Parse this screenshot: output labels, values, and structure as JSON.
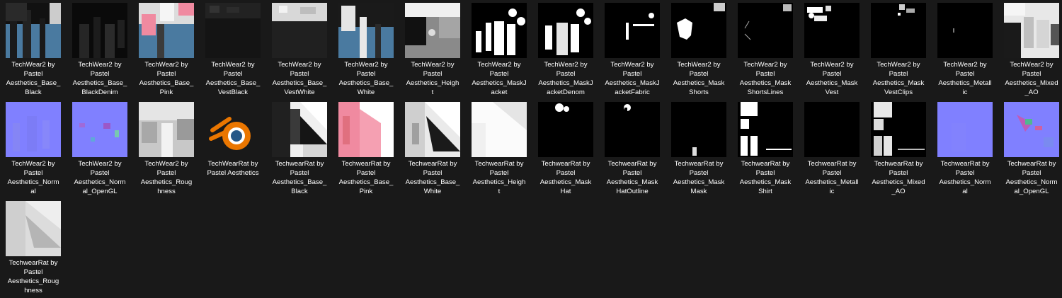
{
  "files": [
    {
      "label": "TechWear2 by\nPastel\nAesthetics_Base_\nBlack",
      "icon": "texture-thumbnail-base-black"
    },
    {
      "label": "TechWear2 by\nPastel\nAesthetics_Base_\nBlackDenim",
      "icon": "texture-thumbnail-base-blackdenim"
    },
    {
      "label": "TechWear2 by\nPastel\nAesthetics_Base_\nPink",
      "icon": "texture-thumbnail-base-pink"
    },
    {
      "label": "TechWear2 by\nPastel\nAesthetics_Base_\nVestBlack",
      "icon": "texture-thumbnail-base-vestblack"
    },
    {
      "label": "TechWear2 by\nPastel\nAesthetics_Base_\nVestWhite",
      "icon": "texture-thumbnail-base-vestwhite"
    },
    {
      "label": "TechWear2 by\nPastel\nAesthetics_Base_\nWhite",
      "icon": "texture-thumbnail-base-white"
    },
    {
      "label": "TechWear2 by\nPastel\nAesthetics_Heigh\nt",
      "icon": "texture-thumbnail-height"
    },
    {
      "label": "TechWear2 by\nPastel\nAesthetics_MaskJ\nacket",
      "icon": "texture-thumbnail-maskjacket"
    },
    {
      "label": "TechWear2 by\nPastel\nAesthetics_MaskJ\nacketDenom",
      "icon": "texture-thumbnail-maskjacketdenom"
    },
    {
      "label": "TechWear2 by\nPastel\nAesthetics_MaskJ\nacketFabric",
      "icon": "texture-thumbnail-maskjacketfabric"
    },
    {
      "label": "TechWear2 by\nPastel\nAesthetics_Mask\nShorts",
      "icon": "texture-thumbnail-maskshorts"
    },
    {
      "label": "TechWear2 by\nPastel\nAesthetics_Mask\nShortsLines",
      "icon": "texture-thumbnail-maskshortslines"
    },
    {
      "label": "TechWear2 by\nPastel\nAesthetics_Mask\nVest",
      "icon": "texture-thumbnail-maskvest"
    },
    {
      "label": "TechWear2 by\nPastel\nAesthetics_Mask\nVestClips",
      "icon": "texture-thumbnail-maskvestclips"
    },
    {
      "label": "TechWear2 by\nPastel\nAesthetics_Metall\nic",
      "icon": "texture-thumbnail-metallic"
    },
    {
      "label": "TechWear2 by\nPastel\nAesthetics_Mixed\n_AO",
      "icon": "texture-thumbnail-mixed-ao"
    },
    {
      "label": "TechWear2 by\nPastel\nAesthetics_Norm\nal",
      "icon": "texture-thumbnail-normal"
    },
    {
      "label": "TechWear2 by\nPastel\nAesthetics_Norm\nal_OpenGL",
      "icon": "texture-thumbnail-normal-opengl"
    },
    {
      "label": "TechWear2 by\nPastel\nAesthetics_Roug\nhness",
      "icon": "texture-thumbnail-roughness"
    },
    {
      "label": "TechWearRat by\nPastel Aesthetics",
      "icon": "blender-icon"
    },
    {
      "label": "TechwearRat by\nPastel\nAesthetics_Base_\nBlack",
      "icon": "texture-thumbnail-rat-base-black"
    },
    {
      "label": "TechwearRat by\nPastel\nAesthetics_Base_\nPink",
      "icon": "texture-thumbnail-rat-base-pink"
    },
    {
      "label": "TechwearRat by\nPastel\nAesthetics_Base_\nWhite",
      "icon": "texture-thumbnail-rat-base-white"
    },
    {
      "label": "TechwearRat by\nPastel\nAesthetics_Heigh\nt",
      "icon": "texture-thumbnail-rat-height"
    },
    {
      "label": "TechwearRat by\nPastel\nAesthetics_Mask\nHat",
      "icon": "texture-thumbnail-rat-maskhat"
    },
    {
      "label": "TechwearRat by\nPastel\nAesthetics_Mask\nHatOutline",
      "icon": "texture-thumbnail-rat-maskhatoutline"
    },
    {
      "label": "TechwearRat by\nPastel\nAesthetics_Mask\nMask",
      "icon": "texture-thumbnail-rat-maskmask"
    },
    {
      "label": "TechwearRat by\nPastel\nAesthetics_Mask\nShirt",
      "icon": "texture-thumbnail-rat-maskshirt"
    },
    {
      "label": "TechwearRat by\nPastel\nAesthetics_Metall\nic",
      "icon": "texture-thumbnail-rat-metallic"
    },
    {
      "label": "TechwearRat by\nPastel\nAesthetics_Mixed\n_AO",
      "icon": "texture-thumbnail-rat-mixed-ao"
    },
    {
      "label": "TechwearRat by\nPastel\nAesthetics_Norm\nal",
      "icon": "texture-thumbnail-rat-normal"
    },
    {
      "label": "TechwearRat by\nPastel\nAesthetics_Norm\nal_OpenGL",
      "icon": "texture-thumbnail-rat-normal-opengl"
    },
    {
      "label": "TechwearRat by\nPastel\nAesthetics_Roug\nhness",
      "icon": "texture-thumbnail-rat-roughness"
    }
  ],
  "colors": {
    "background": "#191919",
    "text": "#ffffff",
    "normal_map": "#8080ff",
    "texture_blue": "#4a7aa0",
    "texture_pink": "#f08aa0",
    "blender_orange": "#ea7600",
    "blender_blue": "#265787"
  }
}
